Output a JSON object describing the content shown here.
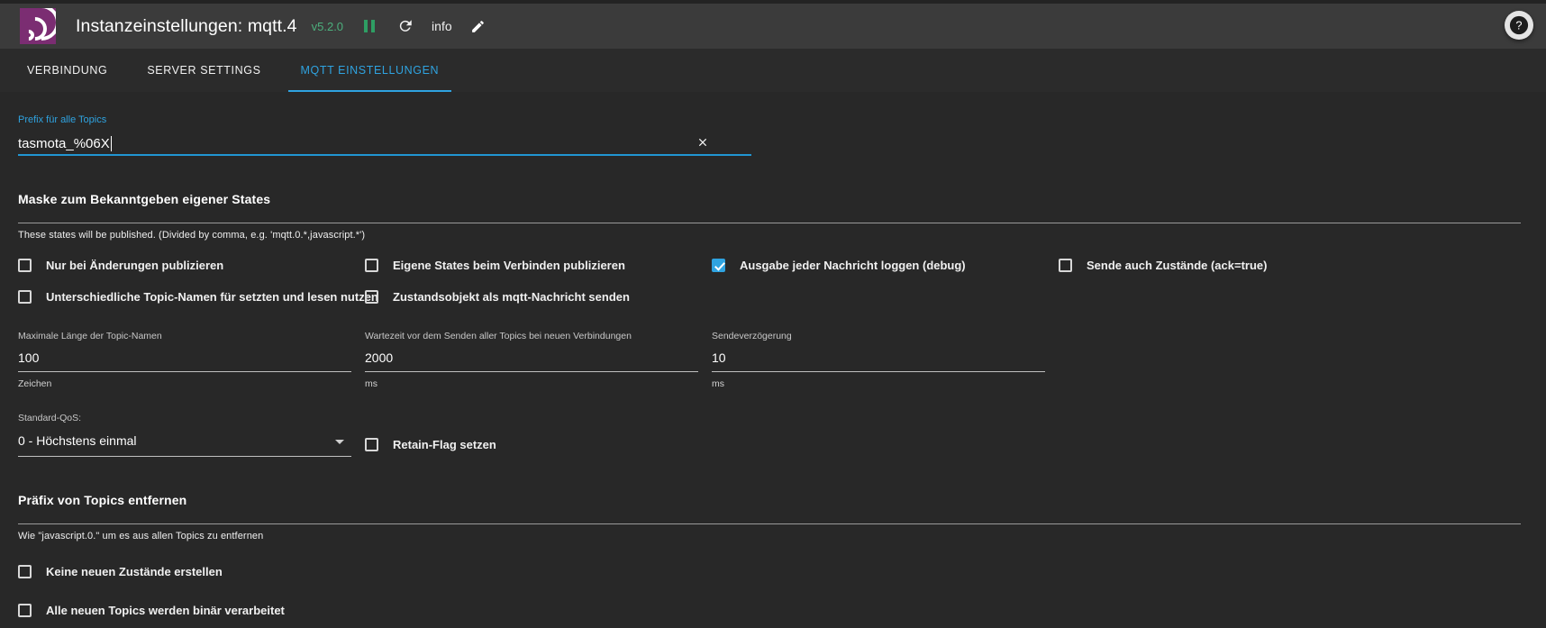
{
  "header": {
    "logo_name": "iobroker-logo",
    "title": "Instanzeinstellungen: mqtt.4",
    "version": "v5.2.0",
    "pause_icon": "pause-icon",
    "refresh_icon": "refresh-icon",
    "info_label": "info",
    "edit_icon": "pencil-icon",
    "help_icon": "help-icon",
    "upload_icon": "upload-icon",
    "download_icon": "download-icon",
    "accent": "#2fa3e0",
    "version_color": "#4caf7d",
    "logo_color": "#7b2d72"
  },
  "tabs": [
    {
      "label": "VERBINDUNG",
      "active": false
    },
    {
      "label": "SERVER SETTINGS",
      "active": false
    },
    {
      "label": "MQTT EINSTELLUNGEN",
      "active": true
    }
  ],
  "prefix_field": {
    "label": "Prefix für alle Topics",
    "value": "tasmota_%06X",
    "placeholder": "",
    "clear_icon": "close-icon"
  },
  "section_states": {
    "title": "Maske zum Bekanntgeben eigener States",
    "hint": "These states will be published. (Divided by comma, e.g. 'mqtt.0.*,javascript.*')",
    "checkbox_rows": [
      [
        {
          "label": "Nur bei Änderungen publizieren",
          "checked": false
        },
        {
          "label": "Eigene States beim Verbinden publizieren",
          "checked": false
        },
        {
          "label": "Ausgabe jeder Nachricht loggen (debug)",
          "checked": true
        },
        {
          "label": "Sende auch Zustände (ack=true)",
          "checked": false
        }
      ],
      [
        {
          "label": "Unterschiedliche Topic-Namen für setzten und lesen nutzen",
          "checked": false
        },
        {
          "label": "Zustandsobjekt als mqtt-Nachricht senden",
          "checked": false
        }
      ]
    ],
    "number_fields": [
      {
        "label": "Maximale Länge der Topic-Namen",
        "value": "100",
        "hint": "Zeichen"
      },
      {
        "label": "Wartezeit vor dem Senden aller Topics bei neuen Verbindungen",
        "value": "2000",
        "hint": "ms"
      },
      {
        "label": "Sendeverzögerung",
        "value": "10",
        "hint": "ms"
      }
    ],
    "qos_select": {
      "label": "Standard-QoS:",
      "value": "0 - Höchstens einmal",
      "caret_icon": "chevron-down-icon"
    },
    "retain_checkbox": {
      "label": "Retain-Flag setzen",
      "checked": false
    }
  },
  "section_prefix_remove": {
    "title": "Präfix von Topics entfernen",
    "hint": "Wie \"javascript.0.\" um es aus allen Topics zu entfernen",
    "checkboxes": [
      {
        "label": "Keine neuen Zustände erstellen",
        "checked": false
      },
      {
        "label": "Alle neuen Topics werden binär verarbeitet",
        "checked": false
      }
    ]
  }
}
